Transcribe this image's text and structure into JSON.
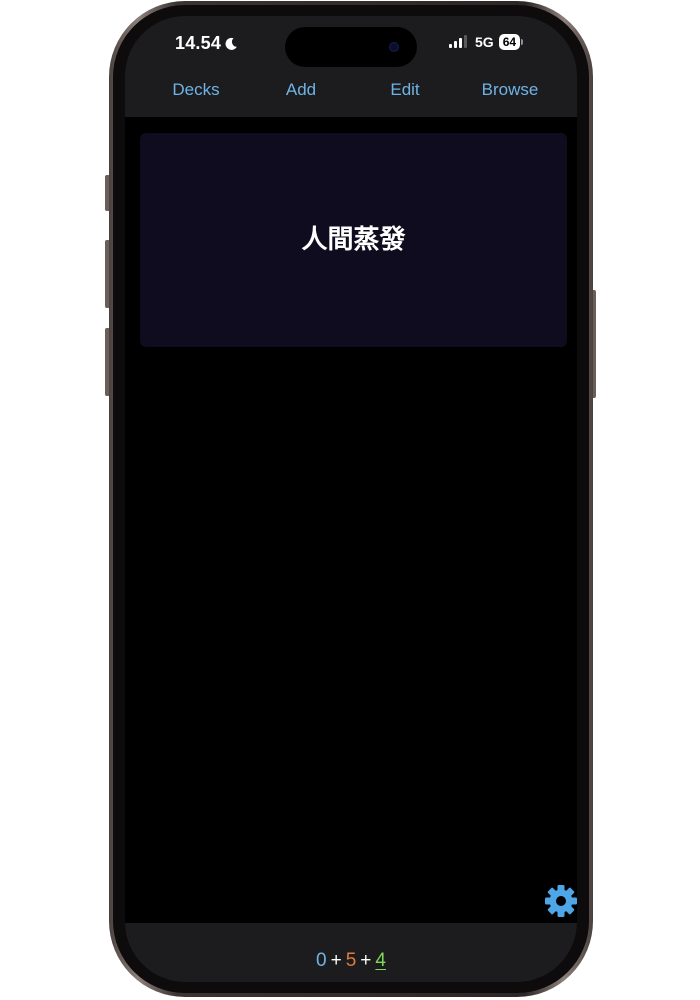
{
  "status_bar": {
    "time": "14.54",
    "network": "5G",
    "battery": "64",
    "icons": [
      "moon-icon",
      "signal-icon",
      "battery-icon"
    ]
  },
  "nav": {
    "items": [
      {
        "label": "Decks"
      },
      {
        "label": "Add"
      },
      {
        "label": "Edit"
      },
      {
        "label": "Browse"
      }
    ]
  },
  "card": {
    "front": "人間蒸發"
  },
  "settings": {
    "icon": "gear-icon"
  },
  "counts": {
    "new": "0",
    "learning": "5",
    "review": "4",
    "separator": "+"
  },
  "colors": {
    "accent": "#6fb3e6",
    "learning": "#e07a3f",
    "review": "#7ed957",
    "card_bg": "#0f0c1f",
    "bar_bg": "#1c1c1e"
  }
}
